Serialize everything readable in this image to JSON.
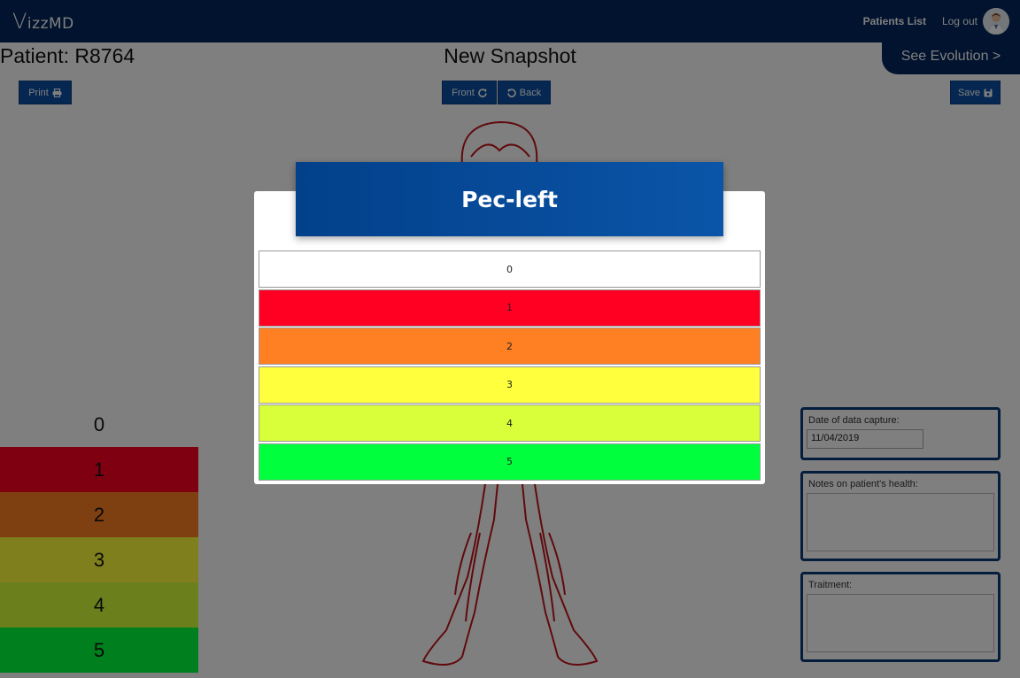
{
  "nav": {
    "logo": "izzMD",
    "patients_list": "Patients List",
    "logout": "Log out"
  },
  "header": {
    "patient_title": "Patient: R8764",
    "snapshot_title": "New Snapshot",
    "see_evolution": "See Evolution >"
  },
  "toolbar": {
    "print_label": "Print",
    "front_label": "Front",
    "back_label": "Back",
    "save_label": "Save"
  },
  "legend": {
    "items": [
      {
        "label": "0",
        "color": "#ffffff"
      },
      {
        "label": "1",
        "color": "#ff0022"
      },
      {
        "label": "2",
        "color": "#ff8022"
      },
      {
        "label": "3",
        "color": "#ffff3d"
      },
      {
        "label": "4",
        "color": "#d8ff3a"
      },
      {
        "label": "5",
        "color": "#00ff3c"
      }
    ]
  },
  "form": {
    "date_label": "Date of data capture:",
    "date_value": "11/04/2019",
    "notes_label": "Notes on patient's health:",
    "treatment_label": "Traitment:"
  },
  "modal": {
    "title": "Pec-left",
    "options": [
      {
        "label": "0",
        "color": "#ffffff"
      },
      {
        "label": "1",
        "color": "#ff0022"
      },
      {
        "label": "2",
        "color": "#ff8022"
      },
      {
        "label": "3",
        "color": "#ffff3d"
      },
      {
        "label": "4",
        "color": "#d8ff3a"
      },
      {
        "label": "5",
        "color": "#00ff3c"
      }
    ]
  },
  "colors": {
    "brand": "#02265c",
    "button": "#0b4ea2",
    "body_outline": "#c0141a"
  }
}
